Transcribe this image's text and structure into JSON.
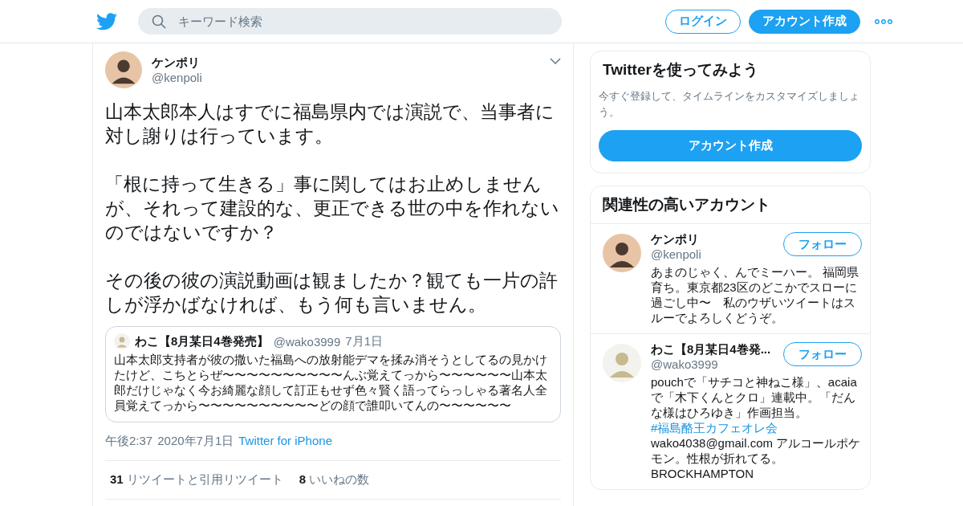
{
  "header": {
    "search": {
      "placeholder": "キーワード検索"
    },
    "login": "ログイン",
    "signup": "アカウント作成"
  },
  "tweet": {
    "author": {
      "name": "ケンポリ",
      "handle": "@kenpoli"
    },
    "paragraphs": [
      "山本太郎本人はすでに福島県内では演説で、当事者に対し謝りは行っています。",
      "「根に持って生きる」事に関してはお止めしませんが、それって建設的な、更正できる世の中を作れないのではないですか？",
      "その後の彼の演説動画は観ましたか？観ても一片の許しが浮かばなければ、もう何も言いません。"
    ],
    "quote": {
      "name": "わこ【8月某日4巻発売】",
      "handle": "@wako3999",
      "date": "7月1日",
      "text": "山本太郎支持者が彼の撒いた福島への放射能デマを揉み消そうとしてるの見かけたけど、こちとらぜ〜〜〜〜〜〜〜〜〜〜んぶ覚えてっから〜〜〜〜〜〜山本太郎だけじゃなく今お綺麗な顔して訂正もせず色々賢く語ってらっしゃる著名人全員覚えてっから〜〜〜〜〜〜〜〜〜〜どの顔で誰叩いてんの〜〜〜〜〜〜"
    },
    "time": "午後2:37",
    "date": "2020年7月1日",
    "source": "Twitter for iPhone",
    "stats": [
      {
        "count": "31",
        "label": "リツイートと引用リツイート"
      },
      {
        "count": "8",
        "label": "いいねの数"
      }
    ]
  },
  "signup_card": {
    "title": "Twitterを使ってみよう",
    "text": "今すぐ登録して、タイムラインをカスタマイズしましょう。",
    "button": "アカウント作成"
  },
  "related": {
    "title": "関連性の高いアカウント",
    "accounts": [
      {
        "name": "ケンポリ",
        "handle": "@kenpoli",
        "follow": "フォロー",
        "bio": [
          {
            "kind": "text",
            "text": "あまのじゃく、んでミーハー。 福岡県育ち。東京都23区のどこかでスローに過ごし中〜　私のウザいツイートはスルーでよろしくどうぞ。"
          }
        ]
      },
      {
        "name": "わこ【8月某日4巻発...",
        "handle": "@wako3999",
        "follow": "フォロー",
        "bio": [
          {
            "kind": "text",
            "text": "pouchで「サチコと神ねこ様」、acaiaで「木下くんとクロ」連載中。「だんな様はひろゆき」作画担当。"
          },
          {
            "kind": "hashtag",
            "text": "#福島酪王カフェオレ会"
          },
          {
            "kind": "text",
            "text": " wako4038@gmail.com アルコールポケモン。性根が折れてる。 BROCKHAMPTON"
          }
        ]
      }
    ]
  }
}
